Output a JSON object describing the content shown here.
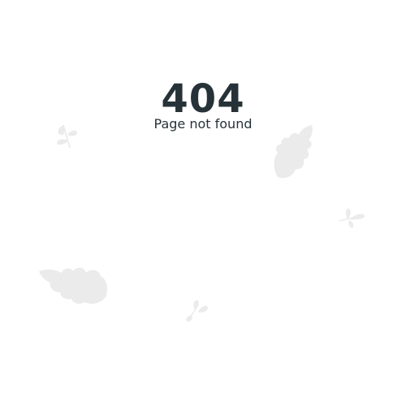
{
  "error": {
    "code": "404",
    "message": "Page not found"
  },
  "colors": {
    "background": "#ffffff",
    "text": "#263238",
    "leaf": "#ebebeb"
  },
  "decorations": [
    "leaf-icon",
    "leaf-icon",
    "leaf-icon",
    "leaf-icon",
    "leaf-icon"
  ]
}
